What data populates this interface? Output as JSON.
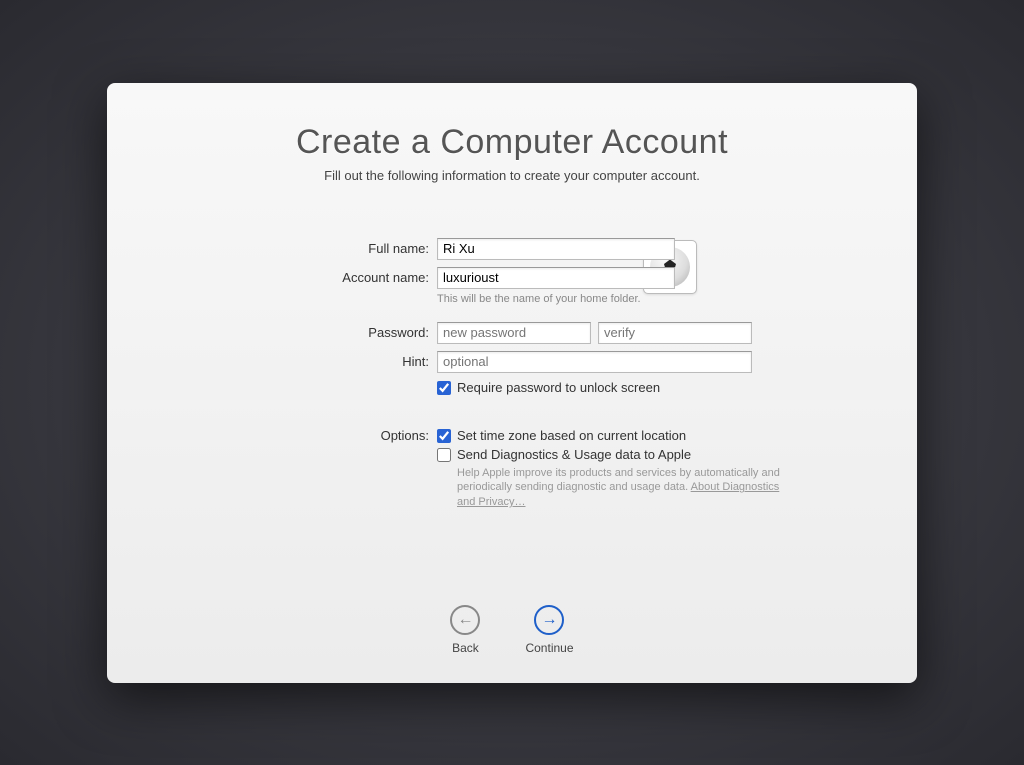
{
  "header": {
    "title": "Create a Computer Account",
    "subtitle": "Fill out the following information to create your computer account."
  },
  "form": {
    "full_name": {
      "label": "Full name:",
      "value": "Ri Xu"
    },
    "account_name": {
      "label": "Account name:",
      "value": "luxurioust",
      "hint": "This will be the name of your home folder."
    },
    "password": {
      "label": "Password:",
      "placeholder_new": "new password",
      "placeholder_verify": "verify"
    },
    "hint": {
      "label": "Hint:",
      "placeholder": "optional"
    },
    "require_password": {
      "label": "Require password to unlock screen",
      "checked": true
    },
    "options_label": "Options:",
    "timezone": {
      "label": "Set time zone based on current location",
      "checked": true
    },
    "diagnostics": {
      "label": "Send Diagnostics & Usage data to Apple",
      "checked": false,
      "help_text": "Help Apple improve its products and services by automatically and periodically sending diagnostic and usage data. ",
      "link_text": "About Diagnostics and Privacy…"
    }
  },
  "avatar": {
    "icon": "soccer-ball"
  },
  "nav": {
    "back": "Back",
    "continue": "Continue"
  }
}
